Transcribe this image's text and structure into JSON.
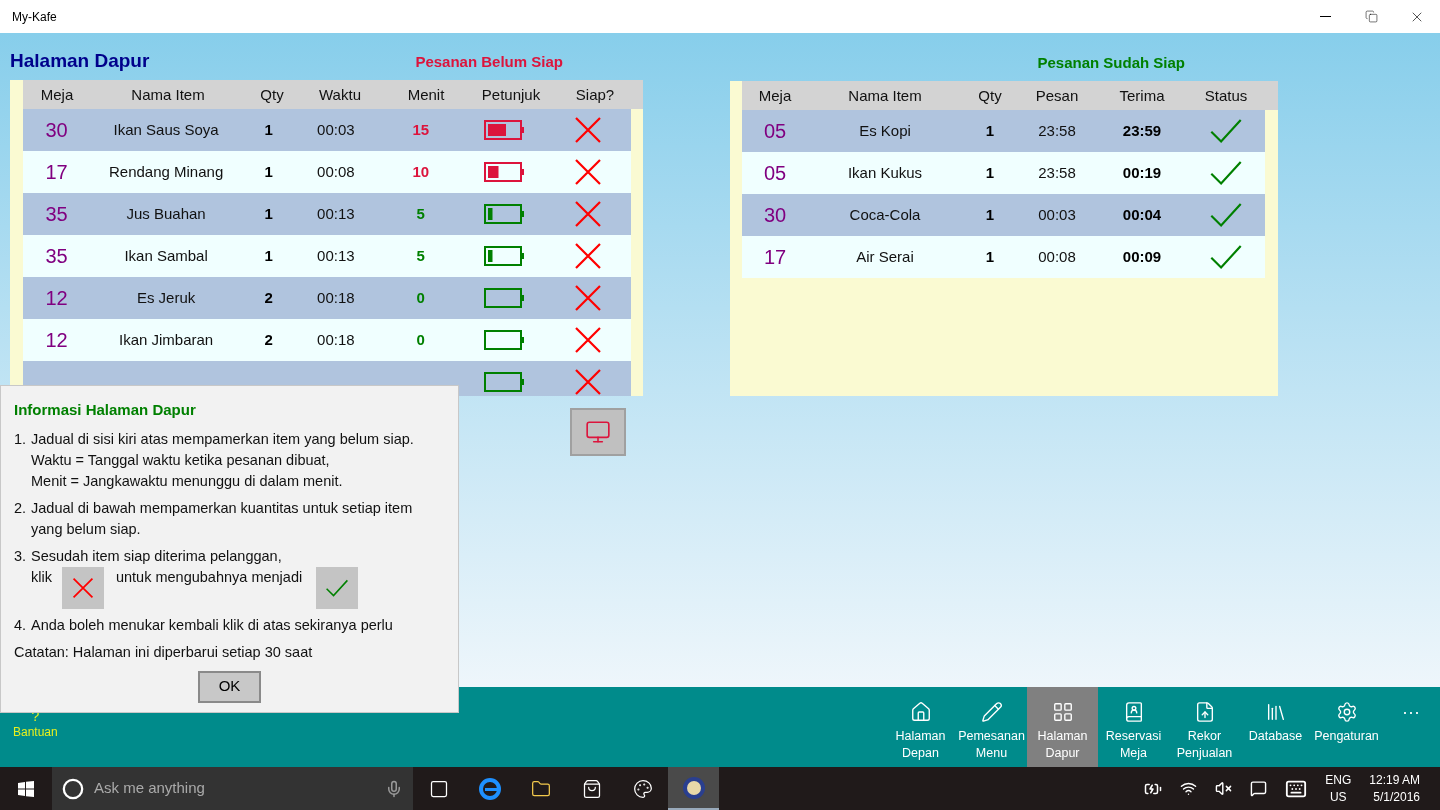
{
  "window": {
    "title": "My-Kafe"
  },
  "page_title": "Halaman Dapur",
  "pending": {
    "title": "Pesanan Belum Siap",
    "columns": [
      "Meja",
      "Nama Item",
      "Qty",
      "Waktu",
      "Menit",
      "Petunjuk",
      "Siap?"
    ],
    "rows": [
      {
        "table": "30",
        "item": "Ikan Saus Soya",
        "qty": "1",
        "time": "00:03",
        "minutes": "15",
        "level": 0.6,
        "color": "#dc143c",
        "ready": false
      },
      {
        "table": "17",
        "item": "Rendang Minang",
        "qty": "1",
        "time": "00:08",
        "minutes": "10",
        "level": 0.35,
        "color": "#dc143c",
        "ready": false
      },
      {
        "table": "35",
        "item": "Jus Buahan",
        "qty": "1",
        "time": "00:13",
        "minutes": "5",
        "level": 0.15,
        "color": "#008000",
        "ready": false
      },
      {
        "table": "35",
        "item": "Ikan Sambal",
        "qty": "1",
        "time": "00:13",
        "minutes": "5",
        "level": 0.15,
        "color": "#008000",
        "ready": false
      },
      {
        "table": "12",
        "item": "Es Jeruk",
        "qty": "2",
        "time": "00:18",
        "minutes": "0",
        "level": 0,
        "color": "#008000",
        "ready": false
      },
      {
        "table": "12",
        "item": "Ikan Jimbaran",
        "qty": "2",
        "time": "00:18",
        "minutes": "0",
        "level": 0,
        "color": "#008000",
        "ready": false
      },
      {
        "level": 0,
        "color": "#008000",
        "ready": false
      }
    ]
  },
  "done": {
    "title": "Pesanan Sudah Siap",
    "columns": [
      "Meja",
      "Nama Item",
      "Qty",
      "Pesan",
      "Terima",
      "Status"
    ],
    "rows": [
      {
        "table": "05",
        "item": "Es Kopi",
        "qty": "1",
        "ordered": "23:58",
        "received": "23:59",
        "ready": true
      },
      {
        "table": "05",
        "item": "Ikan Kukus",
        "qty": "1",
        "ordered": "23:58",
        "received": "00:19",
        "ready": true
      },
      {
        "table": "30",
        "item": "Coca-Cola",
        "qty": "1",
        "ordered": "00:03",
        "received": "00:04",
        "ready": true
      },
      {
        "table": "17",
        "item": "Air Serai",
        "qty": "1",
        "ordered": "00:08",
        "received": "00:09",
        "ready": true
      }
    ]
  },
  "dialog": {
    "title": "Informasi Halaman Dapur",
    "items": [
      {
        "kind": "text",
        "number": "1.",
        "lines": [
          "Jadual di sisi kiri atas mempamerkan item yang belum siap.",
          "Waktu = Tanggal waktu ketika pesanan dibuat,",
          "Menit = Jangkawaktu menunggu di dalam menit."
        ]
      },
      {
        "kind": "text",
        "number": "2.",
        "lines": [
          "Jadual di bawah mempamerkan kuantitas untuk setiap item",
          "yang belum siap."
        ]
      },
      {
        "kind": "toggle",
        "number": "3.",
        "lines": [
          "Sesudah item siap diterima pelanggan,"
        ],
        "before": "klik",
        "after": "untuk mengubahnya menjadi"
      },
      {
        "kind": "text",
        "number": "4.",
        "lines": [
          "Anda boleh menukar kembali klik di atas sekiranya perlu"
        ]
      }
    ],
    "note": "Catatan: Halaman ini diperbarui setiap 30 saat",
    "button": "OK"
  },
  "nav": {
    "help": {
      "icon": "?",
      "label": "Bantuan"
    },
    "items": [
      {
        "lines": [
          "Halaman",
          "Depan"
        ],
        "selected": false
      },
      {
        "lines": [
          "Pemesanan",
          "Menu"
        ],
        "selected": false
      },
      {
        "lines": [
          "Halaman",
          "Dapur"
        ],
        "selected": true
      },
      {
        "lines": [
          "Reservasi",
          "Meja"
        ],
        "selected": false
      },
      {
        "lines": [
          "Rekor",
          "Penjualan"
        ],
        "selected": false
      },
      {
        "lines": [
          "Database"
        ],
        "selected": false
      },
      {
        "lines": [
          "Pengaturan"
        ],
        "selected": false
      }
    ],
    "more": "···"
  },
  "taskbar": {
    "search_placeholder": "Ask me anything",
    "language": "ENG",
    "region": "US",
    "time": "12:19 AM",
    "date": "5/1/2016"
  }
}
